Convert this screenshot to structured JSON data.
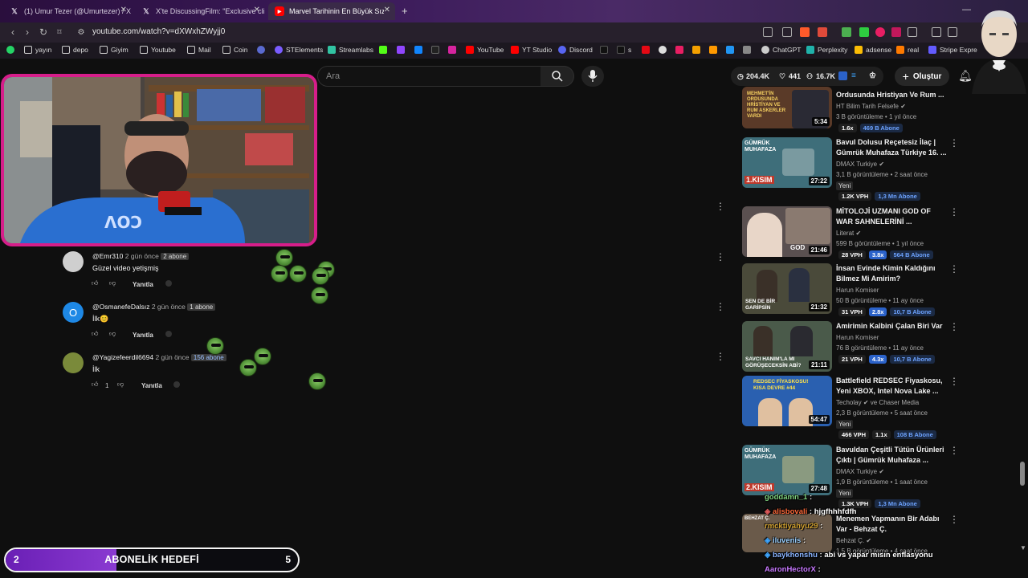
{
  "browser": {
    "tabs": [
      {
        "title": "(1) Umur Tezer (@Umurtezer) / X",
        "icon": "x-logo",
        "active": false
      },
      {
        "title": "X'te DiscussingFilm: \"Exclusive clip fr",
        "icon": "x-logo",
        "active": false
      },
      {
        "title": "Marvel Tarihinin En Büyük Sızıntı",
        "icon": "youtube-logo",
        "active": true
      }
    ],
    "url": "youtube.com/watch?v=dXWxhZWyjj0",
    "bookmarks": [
      "yayın",
      "depo",
      "Giyim",
      "Youtube",
      "Mail",
      "Coin",
      "STElements",
      "Streamlabs",
      "YouTube",
      "YT Studio",
      "Discord",
      "s",
      "real",
      "adsense",
      "Perplexity",
      "ChatGPT",
      "Stripe Expre"
    ]
  },
  "youtube": {
    "search_placeholder": "Ara",
    "stats": {
      "views": "204.4K",
      "likes": "441",
      "subs": "16.7K"
    },
    "create_label": "Oluştur"
  },
  "comments": [
    {
      "author": "@Emr310",
      "time": "2 gün önce",
      "subs": "2 abone",
      "text": "Güzel video yetişmiş",
      "likes": "",
      "reply": "Yanıtla",
      "avatar_letter": "",
      "avatar_color": "#cfcfcf"
    },
    {
      "author": "@OsmanefeDalsız",
      "time": "2 gün önce",
      "subs": "1 abone",
      "text": "İlk😊",
      "likes": "",
      "reply": "Yanıtla",
      "avatar_letter": "O",
      "avatar_color": "#1e88e5"
    },
    {
      "author": "@Yagizefeerdil6694",
      "time": "2 gün önce",
      "subs": "156 abone",
      "text": "İlk",
      "likes": "1",
      "reply": "Yanıtla",
      "avatar_letter": "",
      "avatar_color": "#7a8a3a"
    }
  ],
  "sidebar_videos": [
    {
      "title": "Ordusunda Hristiyan Ve Rum ...",
      "channel": "HT Bilim Tarih Felsefe",
      "meta": "3 B görüntüleme • 1 yıl önce",
      "duration": "5:34",
      "new": "",
      "vph": "",
      "mult": "1.6x",
      "mult_hl": false,
      "subs": "469 B Abone",
      "thumb_color": "#5a3a28",
      "thumb_text": "MEHMET'İN ORDUSUNDA HRİSTİYAN VE RUM ASKERLER VARDI"
    },
    {
      "title": "Bavul Dolusu Reçetesiz İlaç | Gümrük Muhafaza Türkiye 16. ...",
      "channel": "DMAX Turkiye",
      "meta": "3,1 B görüntüleme • 2 saat önce",
      "duration": "27:22",
      "new": "Yeni",
      "vph": "1.2K VPH",
      "mult": "",
      "mult_hl": false,
      "subs": "1,3 Mn Abone",
      "thumb_color": "#3e6e7a",
      "thumb_text": "GÜMRÜK MUHAFAZA 1.KISIM"
    },
    {
      "title": "MİTOLOJİ UZMANI GOD OF WAR SAHNELERİNİ ...",
      "channel": "Literat",
      "meta": "599 B görüntüleme • 1 yıl önce",
      "duration": "21:46",
      "new": "",
      "vph": "28 VPH",
      "mult": "3.8x",
      "mult_hl": true,
      "subs": "564 B Abone",
      "thumb_color": "#5a5050",
      "thumb_text": "GOD"
    },
    {
      "title": "İnsan Evinde Kimin Kaldığını Bilmez Mi Amirim?",
      "channel": "Harun Komiser",
      "meta": "50 B görüntüleme • 11 ay önce",
      "duration": "21:32",
      "new": "",
      "vph": "31 VPH",
      "mult": "2.8x",
      "mult_hl": true,
      "subs": "10,7 B Abone",
      "thumb_color": "#4a4a3a",
      "thumb_text": "SEN DE BİR GARİPSİN"
    },
    {
      "title": "Amirimin Kalbini Çalan Biri Var",
      "channel": "Harun Komiser",
      "meta": "76 B görüntüleme • 11 ay önce",
      "duration": "21:11",
      "new": "",
      "vph": "21 VPH",
      "mult": "4.3x",
      "mult_hl": true,
      "subs": "10,7 B Abone",
      "thumb_color": "#4a5a4a",
      "thumb_text": "SAVCI HANIM'LA MI GÖRÜŞECEKSİN ABİ?"
    },
    {
      "title": "Battlefield REDSEC Fiyaskosu, Yeni XBOX, Intel Nova Lake ...",
      "channel": "Techolay",
      "channel2": "ve Chaser Media",
      "meta": "2,3 B görüntüleme • 5 saat önce",
      "duration": "54:47",
      "new": "Yeni",
      "vph": "466 VPH",
      "mult": "1.1x",
      "mult_hl": false,
      "subs": "108 B Abone",
      "thumb_color": "#2a60b0",
      "thumb_text": "REDSEC FİYASKOSU! KISA DEVRE #44"
    },
    {
      "title": "Bavuldan Çeşitli Tütün Ürünleri Çıktı | Gümrük Muhafaza ...",
      "channel": "DMAX Turkiye",
      "meta": "1,9 B görüntüleme • 1 saat önce",
      "duration": "27:48",
      "new": "Yeni",
      "vph": "1.3K VPH",
      "mult": "",
      "mult_hl": false,
      "subs": "1,3 Mn Abone",
      "thumb_color": "#3e6e7a",
      "thumb_text": "GÜMRÜK MUHAFAZA 2.KISIM"
    },
    {
      "title": "Menemen Yapmanın Bir Adabı Var - Behzat Ç.",
      "channel": "Behzat Ç.",
      "meta": "1,5 B görüntüleme • 4 saat önce",
      "duration": "",
      "new": "",
      "vph": "",
      "mult": "",
      "mult_hl": false,
      "subs": "",
      "thumb_color": "#6a5a4a",
      "thumb_text": "BEHZAT Ç."
    }
  ],
  "chat": [
    {
      "user": "goddamn_1",
      "msg": "",
      "color": "#7fd37f"
    },
    {
      "user": "alisbovali",
      "msg": "hjgfhhhfdfh",
      "color": "#ff6a3a"
    },
    {
      "user": "rmcktiyahyu29",
      "msg": "",
      "color": "#d0a030"
    },
    {
      "user": "iluvenis",
      "msg": "",
      "color": "#9ad0ff"
    },
    {
      "user": "baykhonshu",
      "msg": "abi vs yapar mısın enflasyonu",
      "color": "#8ab4ff"
    },
    {
      "user": "AaronHectorX",
      "msg": "",
      "color": "#c879ff"
    }
  ],
  "goal": {
    "start": "2",
    "label": "ABONELİK HEDEFİ",
    "end": "5",
    "fill_fraction": 0.38
  },
  "colors": {
    "accent": "#d61e8a",
    "goal_fill": "#7a2fc4",
    "yt_blue": "#3ea6ff"
  }
}
